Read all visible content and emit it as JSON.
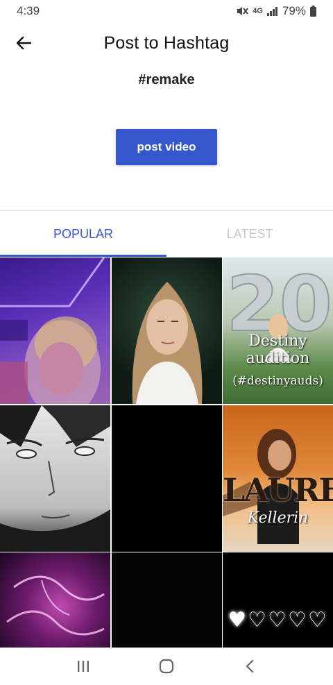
{
  "status": {
    "time": "4:39",
    "network": "4G",
    "battery": "79%",
    "icons": [
      "mute-icon",
      "lte-icon",
      "signal-icon",
      "battery-icon"
    ]
  },
  "header": {
    "title": "Post to Hashtag",
    "back_icon": "arrow-left-icon"
  },
  "hashtag": "#remake",
  "post_button": "post video",
  "tabs": [
    {
      "label": "POPULAR",
      "active": true
    },
    {
      "label": "LATEST",
      "active": false
    }
  ],
  "grid": {
    "tiles": [
      {
        "name": "video-thumbnail-neon-room"
      },
      {
        "name": "video-thumbnail-blonde-girl"
      },
      {
        "name": "video-thumbnail-destiny-audition",
        "title": "Destiny audition",
        "subtitle": "(#destinyauds)",
        "balloon": "20"
      },
      {
        "name": "video-thumbnail-anime-sketch"
      },
      {
        "name": "video-thumbnail-black"
      },
      {
        "name": "video-thumbnail-lauren-kellerin",
        "title": "LAUREN",
        "subtitle": "Kellerin"
      },
      {
        "name": "video-thumbnail-purple-smoke"
      },
      {
        "name": "video-thumbnail-dark"
      },
      {
        "name": "video-thumbnail-hearts",
        "hearts": "♥♡♡♡♡"
      }
    ]
  },
  "nav": {
    "recents_icon": "recents-icon",
    "home_icon": "home-icon",
    "back_icon": "back-chevron-icon"
  },
  "colors": {
    "accent": "#3556cc",
    "inactive_tab": "#c8c8c8"
  }
}
